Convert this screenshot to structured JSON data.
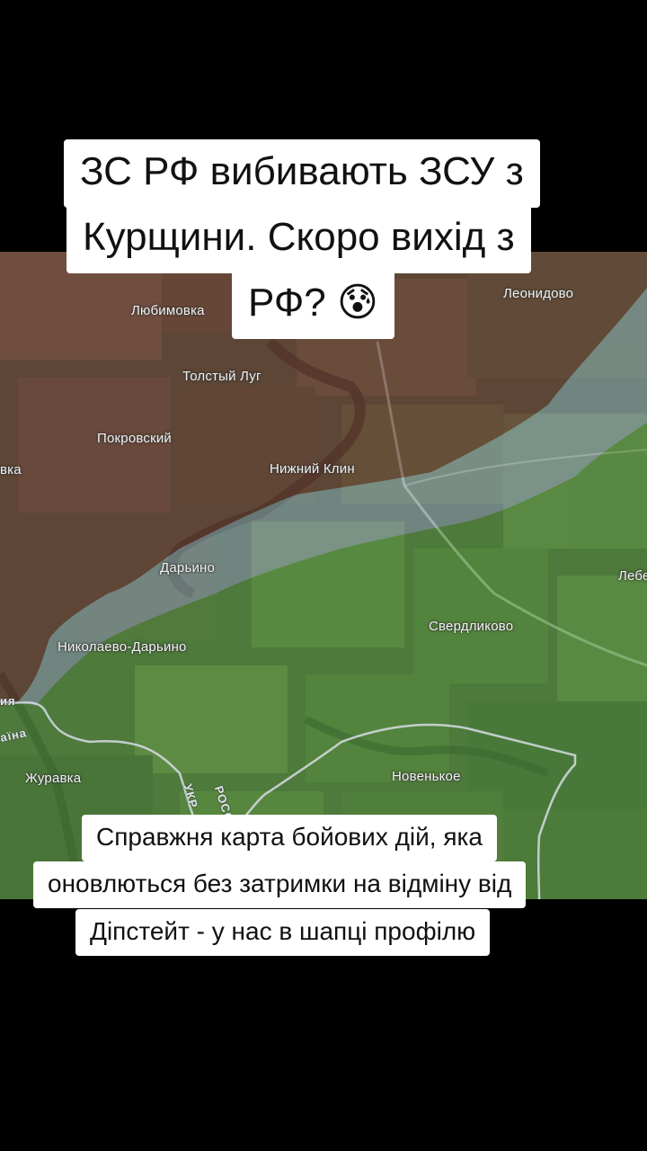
{
  "title": {
    "lines": [
      "ЗС РФ вибивають ЗСУ з",
      "Курщини. Скоро вихід з",
      "РФ? 😰"
    ]
  },
  "map": {
    "places": {
      "lyubimovka": "Любимовка",
      "leonidovo": "Леонидово",
      "tolstyi_lug": "Толстый Луг",
      "pokrovskiy": "Покровский",
      "vka": "вка",
      "nizhniy_klin": "Нижний Клин",
      "daryino": "Дарьино",
      "lebe": "Лебе",
      "sverdlikovo": "Свердликово",
      "nikolaevo_daryino": "Николаево-Дарьино",
      "zhuravka": "Журавка",
      "novenkoe": "Новенькое"
    },
    "border_labels": {
      "rossiya_left": "ия",
      "ukraina_left": "аїна",
      "rossiya_road": "РОССИ",
      "ukraina_road": "УКР"
    },
    "colors": {
      "russian_controlled": "#6e4a45",
      "ukrainian_controlled": "#5c9a48",
      "contested": "#7f9aa0"
    }
  },
  "subtitle": {
    "lines": [
      "Справжня карта бойових дій, яка",
      "оновлються без затримки на відміну від",
      "Діпстейт - у нас в шапці профілю"
    ]
  }
}
